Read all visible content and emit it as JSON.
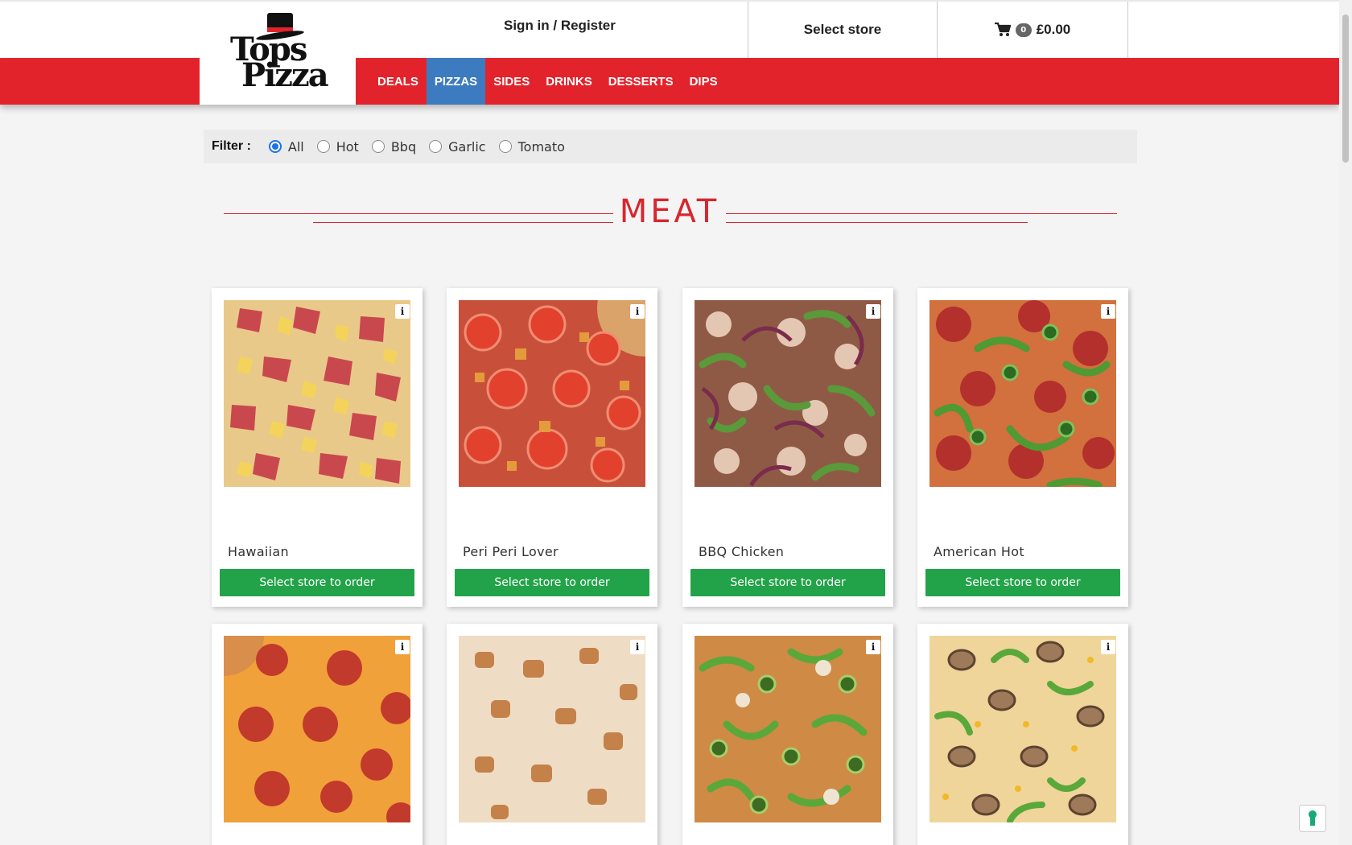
{
  "header": {
    "logo_line1": "Tops",
    "logo_line2": "Pizza",
    "signin_label": "Sign in / Register",
    "store_label": "Select store",
    "cart_count": "0",
    "cart_total": "£0.00"
  },
  "nav": {
    "items": [
      {
        "label": "DEALS",
        "active": false
      },
      {
        "label": "PIZZAS",
        "active": true
      },
      {
        "label": "SIDES",
        "active": false
      },
      {
        "label": "DRINKS",
        "active": false
      },
      {
        "label": "DESSERTS",
        "active": false
      },
      {
        "label": "DIPS",
        "active": false
      }
    ]
  },
  "filter": {
    "label": "Filter :",
    "selected": "All",
    "options": [
      "All",
      "Hot",
      "Bbq",
      "Garlic",
      "Tomato"
    ]
  },
  "section": {
    "title": "MEAT"
  },
  "products": [
    {
      "name": "Hawaiian",
      "button": "Select store to order",
      "info": "i"
    },
    {
      "name": "Peri Peri Lover",
      "button": "Select store to order",
      "info": "i"
    },
    {
      "name": "BBQ Chicken",
      "button": "Select store to order",
      "info": "i"
    },
    {
      "name": "American Hot",
      "button": "Select store to order",
      "info": "i"
    },
    {
      "name": "",
      "button": "",
      "info": "i"
    },
    {
      "name": "",
      "button": "",
      "info": "i"
    },
    {
      "name": "",
      "button": "",
      "info": "i"
    },
    {
      "name": "",
      "button": "",
      "info": "i"
    }
  ],
  "colors": {
    "brand_red": "#e3232b",
    "nav_active": "#3c7bbf",
    "order_green": "#22a349"
  }
}
